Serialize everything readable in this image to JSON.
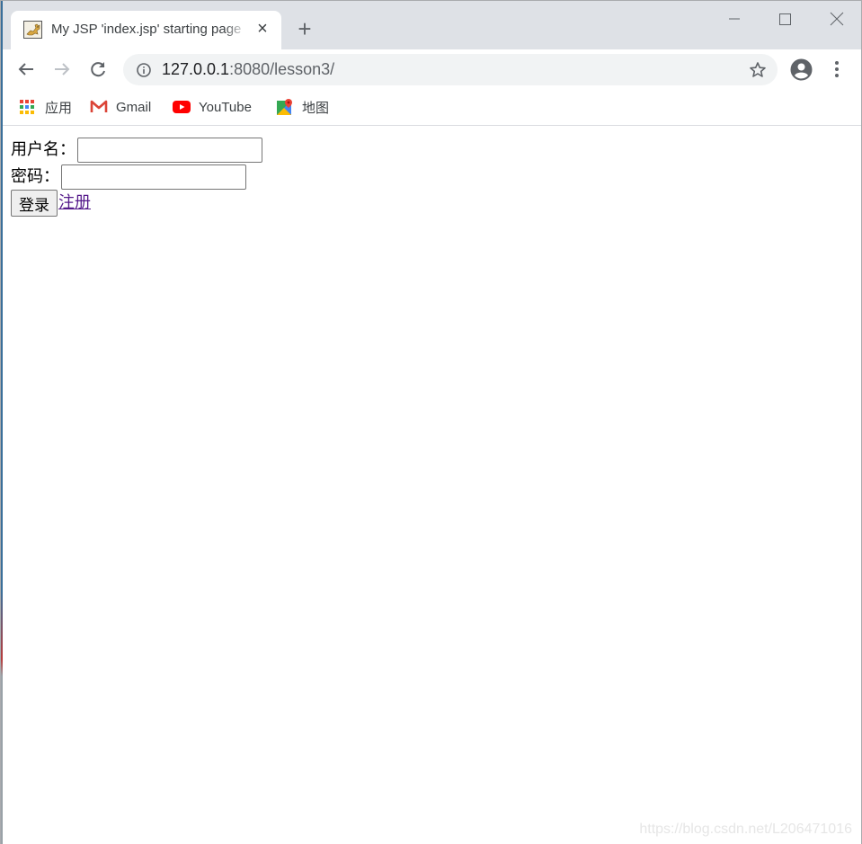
{
  "browser": {
    "tab": {
      "title": "My JSP 'index.jsp' starting page",
      "favicon": "tomcat-icon",
      "close_icon": "close-icon"
    },
    "new_tab_icon": "plus-icon",
    "window_controls": {
      "minimize": "minimize-icon",
      "maximize": "maximize-icon",
      "close": "close-icon"
    },
    "toolbar": {
      "back_icon": "arrow-left-icon",
      "forward_icon": "arrow-right-icon",
      "reload_icon": "reload-icon",
      "site_info_icon": "info-icon",
      "url_host": "127.0.0.1",
      "url_rest": ":8080/lesson3/",
      "bookmark_icon": "star-icon",
      "profile_icon": "account-icon",
      "menu_icon": "more-vert-icon"
    },
    "bookmarks": [
      {
        "label": "应用",
        "icon": "apps-grid-icon"
      },
      {
        "label": "Gmail",
        "icon": "gmail-icon"
      },
      {
        "label": "YouTube",
        "icon": "youtube-icon"
      },
      {
        "label": "地图",
        "icon": "maps-icon"
      }
    ]
  },
  "page": {
    "username_label": "用户名：",
    "username_value": "",
    "password_label": "密码：",
    "password_value": "",
    "login_button": "登录",
    "register_link": "注册",
    "colors": {
      "link_visited": "#551a8b"
    }
  },
  "watermark": "https://blog.csdn.net/L206471016"
}
